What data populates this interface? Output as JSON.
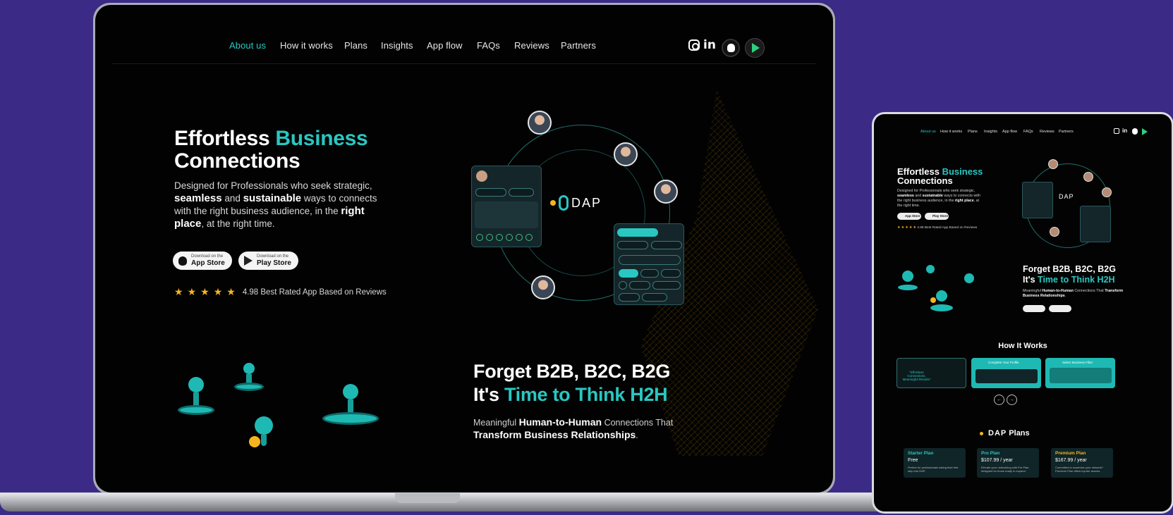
{
  "colors": {
    "background": "#3b2a86",
    "accent": "#29c7c2",
    "star": "#f6b51e"
  },
  "nav": {
    "items": [
      {
        "label": "About us",
        "active": true
      },
      {
        "label": "How it works"
      },
      {
        "label": "Plans"
      },
      {
        "label": "Insights"
      },
      {
        "label": "App flow"
      },
      {
        "label": "FAQs"
      },
      {
        "label": "Reviews"
      },
      {
        "label": "Partners"
      }
    ],
    "social_icons": [
      "instagram-icon",
      "linkedin-icon",
      "apple-icon",
      "google-play-icon"
    ],
    "linkedin_text": "in"
  },
  "hero": {
    "title_line1_a": "Effortless",
    "title_line1_b": "Business",
    "title_line2": "Connections",
    "desc": {
      "p1": "Designed for Professionals who seek strategic,",
      "b1": "seamless",
      "p2": "and",
      "b2": "sustainable",
      "p3": "ways to connects with the right business audience, in the",
      "b3": "right place",
      "p4": ", at the right time."
    },
    "app_store": {
      "small": "Download on the",
      "big": "App Store"
    },
    "play_store": {
      "small": "Download on the",
      "big": "Play Store"
    },
    "rating_text": "4.98 Best Rated App Based on Reviews",
    "stars": 5
  },
  "center_visual": {
    "logo_text": "DAP"
  },
  "forget": {
    "line1": "Forget B2B, B2C, B2G",
    "line2_a": "It's",
    "line2_b": "Time to Think H2H",
    "desc_p1": "Meaningful",
    "desc_b1": "Human-to-Human",
    "desc_p2": "Connections That",
    "desc_b2": "Transform Business Relationships",
    "desc_p3": "."
  },
  "tablet": {
    "nav": [
      "About us",
      "How it works",
      "Plans",
      "Insights",
      "App flow",
      "FAQs",
      "Reviews",
      "Partners"
    ],
    "social_icons": [
      "instagram-icon",
      "linkedin-icon",
      "apple-icon",
      "google-play-icon"
    ],
    "linkedin_text": "in",
    "title_a": "Effortless",
    "title_b": "Business",
    "title_c": "Connections",
    "desc_p1": "Designed for Professionals who seek strategic,",
    "desc_b1": "seamless",
    "desc_p2": "and",
    "desc_b2": "sustainable",
    "desc_p3": "ways to connects with the right business audience, in the",
    "desc_b3": "right place",
    "desc_p4": ", at the right time.",
    "app_store": "App Store",
    "play_store": "Play Store",
    "stars": "★ ★ ★ ★ ★",
    "rating": "4.98 Best Rated App Based on Reviews",
    "logo_text": "DAP",
    "forget_line1": "Forget B2B, B2C, B2G",
    "forget_line2_a": "It's",
    "forget_line2_b": "Time to Think H2H",
    "forget_desc_p1": "Meaningful",
    "forget_desc_b1": "Human-to-Human",
    "forget_desc_p2": "Connections That",
    "forget_desc_b2": "Transform Business Relationships",
    "forget_desc_p3": ".",
    "how_title": "How It Works",
    "how_cards": [
      {
        "label": "\"Effortless Connections, Meaningful Results\""
      },
      {
        "label": "Complete Your Profile"
      },
      {
        "label": "Select Business Filter"
      }
    ],
    "arrow_prev": "←",
    "arrow_next": "→",
    "plans_title": "Plans",
    "plans": [
      {
        "name": "Starter Plan",
        "price": "Free",
        "desc": "Perfect for professionals taking their first step into DAP."
      },
      {
        "name": "Pro Plan",
        "price": "$107.99 / year",
        "desc": "Elevate your networking with Pro Plan, designed for those ready to expand."
      },
      {
        "name": "Premium Plan",
        "price": "$167.99 / year",
        "desc": "Committed to maximize your network? Premium Plan offers top-tier access."
      }
    ]
  }
}
